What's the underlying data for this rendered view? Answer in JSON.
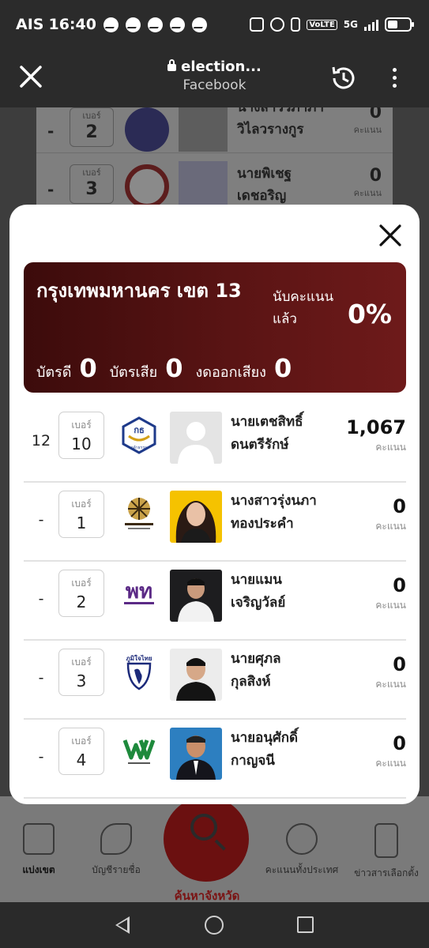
{
  "status_bar": {
    "carrier": "AIS",
    "time": "16:40",
    "volte": "VoLTE",
    "network": "5G"
  },
  "browser": {
    "title": "election...",
    "subtitle": "Facebook"
  },
  "background_list": [
    {
      "number_label": "เบอร์",
      "number": "2",
      "name_line1": "นางสาววิภาภา",
      "name_line2": "วิไลวรางกูร",
      "score": "0",
      "unit": "คะแนน",
      "rank": "-"
    },
    {
      "number_label": "เบอร์",
      "number": "3",
      "name_line1": "นายพิเชฐ",
      "name_line2": "เดชอริญ",
      "score": "0",
      "unit": "คะแนน",
      "rank": "-"
    }
  ],
  "modal": {
    "title": "กรุงเทพมหานคร เขต 13",
    "count_label": "นับคะแนนแล้ว",
    "percent": "0%",
    "valid_label": "บัตรดี",
    "valid": "0",
    "invalid_label": "บัตรเสีย",
    "invalid": "0",
    "abstain_label": "งดออกเสียง",
    "abstain": "0",
    "candidates": [
      {
        "rank": "12",
        "number_label": "เบอร์",
        "number": "10",
        "name_line1": "นายเตชสิทธิ์",
        "name_line2": "ดนตรีรักษ์",
        "score": "1,067",
        "unit": "คะแนน",
        "party_logo": "kla-party-logo",
        "party_text": "กล้าธรรม"
      },
      {
        "rank": "-",
        "number_label": "เบอร์",
        "number": "1",
        "name_line1": "นางสาวรุ่งนภา",
        "name_line2": "ทองประคำ",
        "score": "0",
        "unit": "คะแนน",
        "party_logo": "economic-party-logo",
        "party_text": "พรรคเศรษฐกิจ"
      },
      {
        "rank": "-",
        "number_label": "เบอร์",
        "number": "2",
        "name_line1": "นายแมน",
        "name_line2": "เจริญวัลย์",
        "score": "0",
        "unit": "คะแนน",
        "party_logo": "pheu-thai-logo",
        "party_text": "พรรคเพื่อไทย"
      },
      {
        "rank": "-",
        "number_label": "เบอร์",
        "number": "3",
        "name_line1": "นายศุภล",
        "name_line2": "กุลสิงห์",
        "score": "0",
        "unit": "คะแนน",
        "party_logo": "bhumjaithai-logo",
        "party_text": "ภูมิใจไทย"
      },
      {
        "rank": "-",
        "number_label": "เบอร์",
        "number": "4",
        "name_line1": "นายอนุศักดิ์",
        "name_line2": "กาญจนี",
        "score": "0",
        "unit": "คะแนน",
        "party_logo": "palang-pracharath-logo",
        "party_text": "พรรคพลวัต"
      }
    ]
  },
  "bottom_nav": [
    {
      "label": "แบ่งเขต",
      "icon": "ballot-box-icon",
      "active": true
    },
    {
      "label": "บัญชีรายชื่อ",
      "icon": "vote-hand-icon",
      "active": false
    },
    {
      "label": "คะแนนทั้งประเทศ",
      "icon": "people-icon",
      "active": false
    },
    {
      "label": "ข่าวสารเลือกตั้ง",
      "icon": "phone-video-icon",
      "active": false
    }
  ],
  "search_label": "ค้นหาจังหวัด",
  "colors": {
    "summary_bg": "#5a1414",
    "accent_red": "#c8102e"
  }
}
